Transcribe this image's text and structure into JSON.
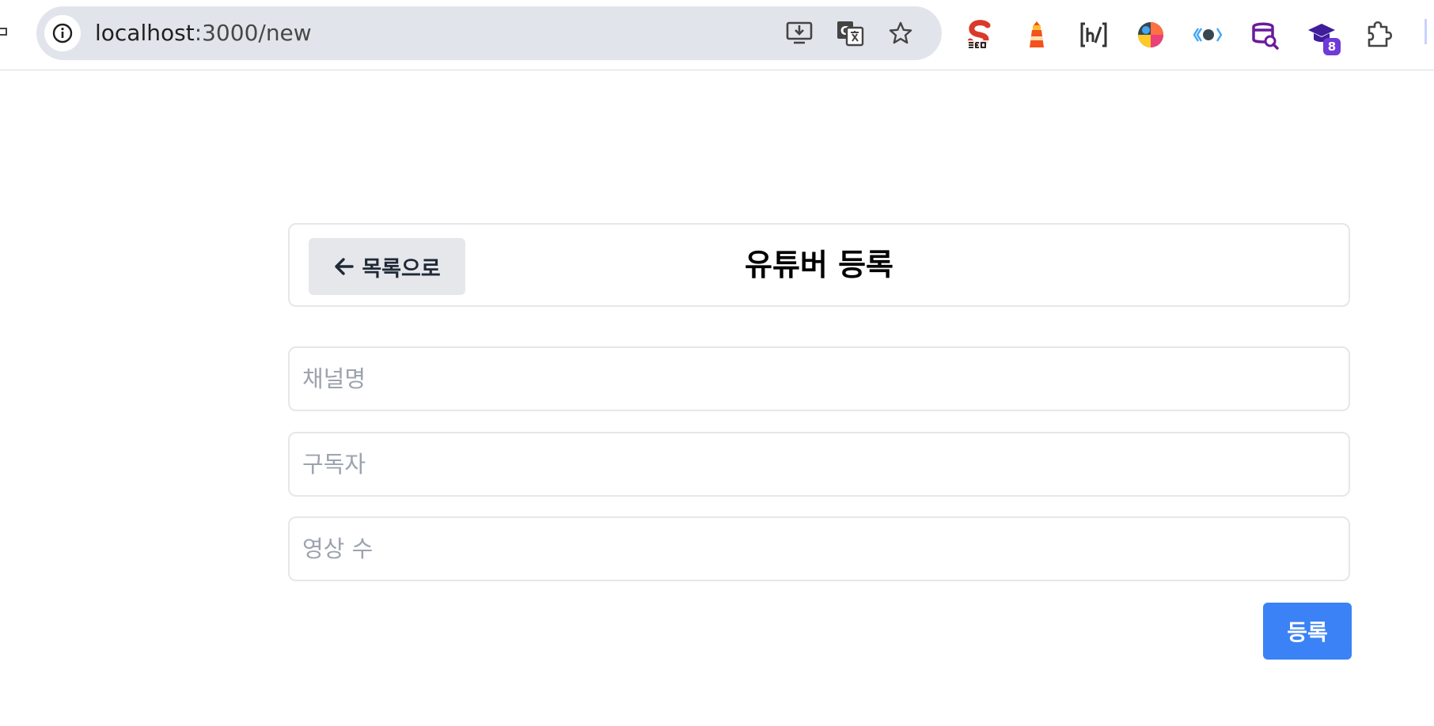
{
  "browser": {
    "url_host": "localhost",
    "url_rest": ":3000/new",
    "extension_badge": "8",
    "colors": {
      "badge": "#6f3ad6",
      "omnibox": "#e1e5eb"
    }
  },
  "header": {
    "back_label": "목록으로",
    "title": "유튜버 등록"
  },
  "form": {
    "channel_placeholder": "채널명",
    "subscribers_placeholder": "구독자",
    "videos_placeholder": "영상 수",
    "channel_value": "",
    "subscribers_value": "",
    "videos_value": "",
    "submit_label": "등록",
    "colors": {
      "submit": "#3b82f6",
      "back": "#e5e7eb",
      "border": "#e5e7eb"
    }
  }
}
